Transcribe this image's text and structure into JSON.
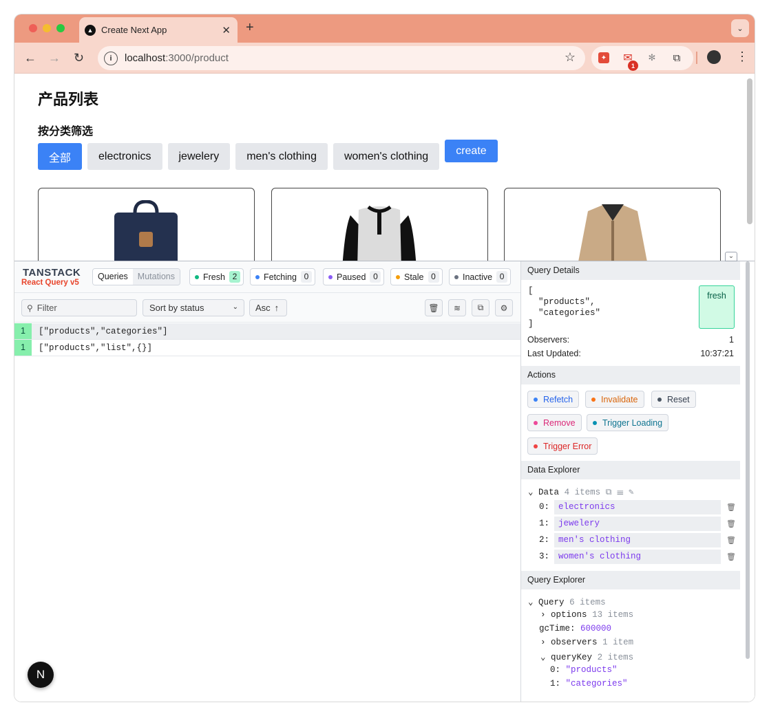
{
  "browser": {
    "tab_title": "Create Next App",
    "url_host": "localhost",
    "url_path": ":3000/product",
    "mail_badge": "1"
  },
  "page": {
    "title": "产品列表",
    "filter_heading": "按分类筛选",
    "filters": [
      "全部",
      "electronics",
      "jewelery",
      "men's clothing",
      "women's clothing"
    ],
    "create_label": "create"
  },
  "devtools": {
    "logo_top": "TANSTACK",
    "logo_bottom": "React Query v5",
    "tabs": {
      "queries": "Queries",
      "mutations": "Mutations"
    },
    "status": {
      "fresh": {
        "label": "Fresh",
        "count": "2"
      },
      "fetching": {
        "label": "Fetching",
        "count": "0"
      },
      "paused": {
        "label": "Paused",
        "count": "0"
      },
      "stale": {
        "label": "Stale",
        "count": "0"
      },
      "inactive": {
        "label": "Inactive",
        "count": "0"
      }
    },
    "filter_placeholder": "Filter",
    "sort_label": "Sort by status",
    "order_label": "Asc",
    "queries": [
      {
        "count": "1",
        "key": "[\"products\",\"categories\"]"
      },
      {
        "count": "1",
        "key": "[\"products\",\"list\",{}]"
      }
    ],
    "details": {
      "heading": "Query Details",
      "key_text": "[\n  \"products\",\n  \"categories\"\n]",
      "status": "fresh",
      "observers_label": "Observers:",
      "observers_value": "1",
      "updated_label": "Last Updated:",
      "updated_value": "10:37:21"
    },
    "actions": {
      "heading": "Actions",
      "refetch": "Refetch",
      "invalidate": "Invalidate",
      "reset": "Reset",
      "remove": "Remove",
      "trigger_loading": "Trigger Loading",
      "trigger_error": "Trigger Error"
    },
    "data_explorer": {
      "heading": "Data Explorer",
      "root_label": "Data",
      "root_count": "4 items",
      "items": [
        {
          "index": "0:",
          "value": "electronics"
        },
        {
          "index": "1:",
          "value": "jewelery"
        },
        {
          "index": "2:",
          "value": "men's clothing"
        },
        {
          "index": "3:",
          "value": "women's clothing"
        }
      ]
    },
    "query_explorer": {
      "heading": "Query Explorer",
      "root_label": "Query",
      "root_count": "6 items",
      "options_label": "options",
      "options_count": "13 items",
      "gctime_label": "gcTime:",
      "gctime_value": "600000",
      "observers_label": "observers",
      "observers_count": "1 item",
      "querykey_label": "queryKey",
      "querykey_count": "2 items",
      "key0_index": "0:",
      "key0_value": "\"products\"",
      "key1_index": "1:",
      "key1_value": "\"categories\""
    }
  },
  "colors": {
    "fresh": "#10b981",
    "fetching": "#3b82f6",
    "paused": "#8b5cf6",
    "stale": "#f59e0b",
    "inactive": "#6b7280",
    "accent": "#3b82f6"
  }
}
